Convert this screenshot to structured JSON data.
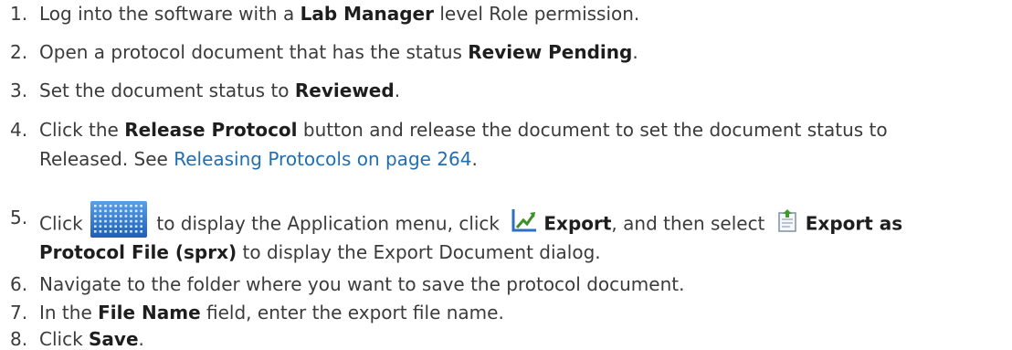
{
  "steps": [
    {
      "num": "1.",
      "t1": "Log into the software with a ",
      "b1": "Lab Manager",
      "t2": " level Role permission."
    },
    {
      "num": "2.",
      "t1": "Open a protocol document that has the status ",
      "b1": "Review Pending",
      "t2": "."
    },
    {
      "num": "3.",
      "t1": "Set the document status to ",
      "b1": "Reviewed",
      "t2": "."
    },
    {
      "num": "4.",
      "t1": "Click the ",
      "b1": "Release Protocol",
      "t2": " button and release the document to set the document status to",
      "line2": "Released. See ",
      "link": "Releasing Protocols on page 264",
      "t3": "."
    },
    {
      "num": "5.",
      "t1": "Click ",
      "t2": " to display the Application menu, click ",
      "b1": "Export",
      "t3": ", and then select ",
      "b2": "Export as",
      "b3": "Protocol File (sprx)",
      "t4": " to display the Export Document dialog."
    },
    {
      "num": "6.",
      "t1": "Navigate to the folder where you want to save the protocol document."
    },
    {
      "num": "7.",
      "t1": "In the ",
      "b1": "File Name",
      "t2": " field, enter the export file name."
    },
    {
      "num": "8.",
      "t1": "Click ",
      "b1": "Save",
      "t2": "."
    }
  ],
  "icons": {
    "application_menu": "application-menu-grid-icon",
    "export": "export-chart-icon",
    "export_protocol_file": "export-protocol-file-icon"
  },
  "colors": {
    "text": "#3b3b3b",
    "bold": "#1e1e1e",
    "link": "#1f6fb2"
  }
}
